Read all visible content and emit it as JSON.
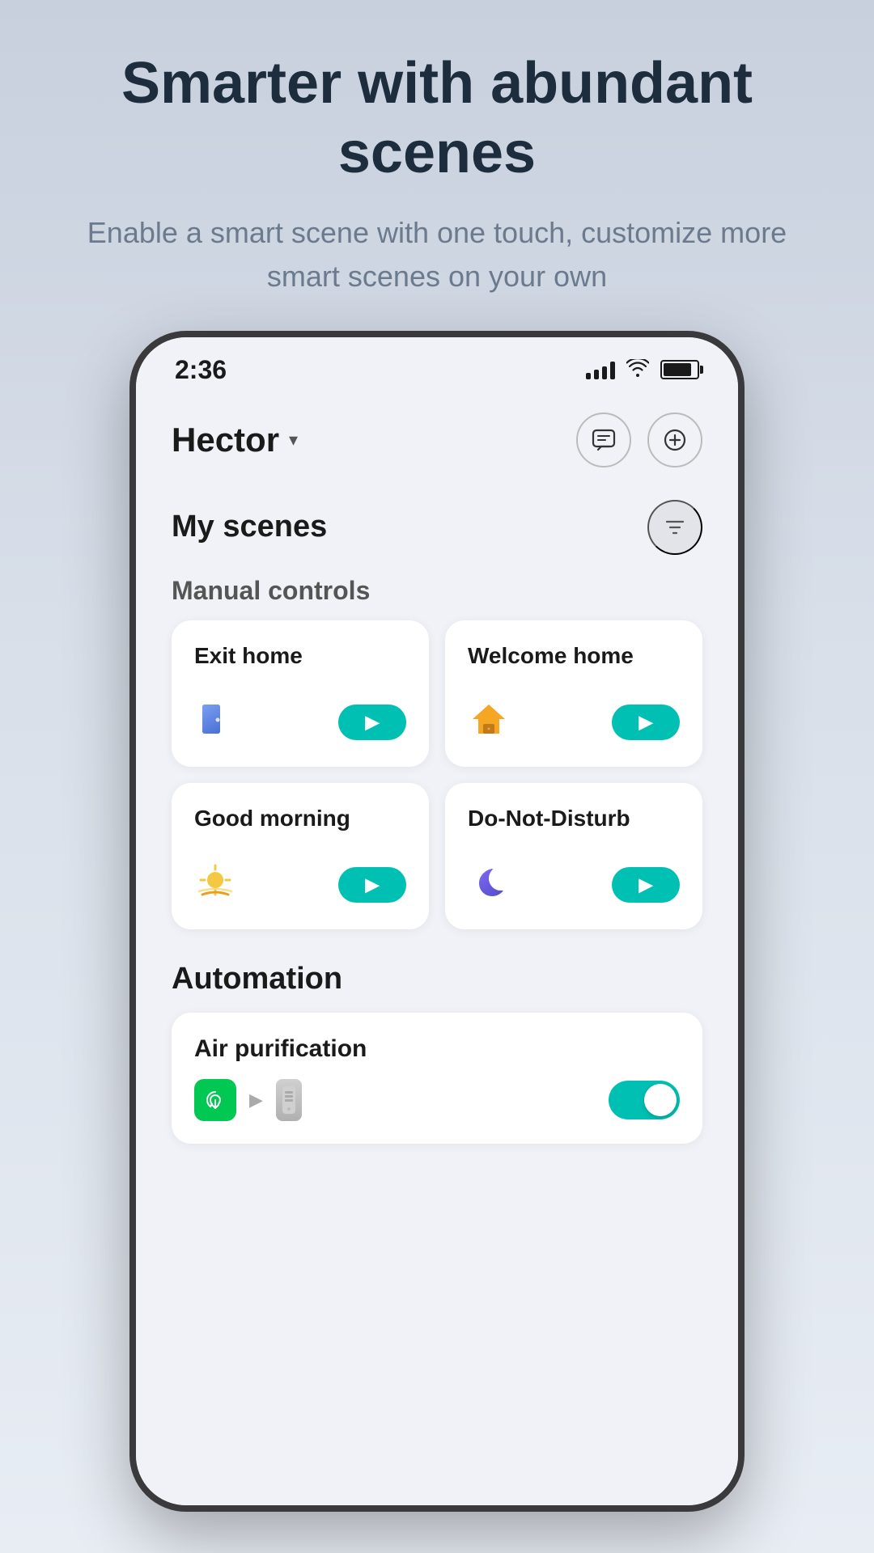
{
  "promo": {
    "title": "Smarter with abundant scenes",
    "subtitle": "Enable a smart scene with one touch, customize more smart scenes on your own"
  },
  "status_bar": {
    "time": "2:36",
    "signal_aria": "signal bars",
    "wifi_aria": "wifi",
    "battery_aria": "battery"
  },
  "header": {
    "user_name": "Hector",
    "message_icon": "💬",
    "add_icon": "+"
  },
  "my_scenes": {
    "title": "My scenes",
    "filter_icon": "▽",
    "manual_controls": {
      "label": "Manual controls",
      "scenes": [
        {
          "title": "Exit home",
          "icon": "🚪",
          "icon_type": "door"
        },
        {
          "title": "Welcome home",
          "icon": "🏠",
          "icon_type": "house"
        },
        {
          "title": "Good morning",
          "icon": "🌅",
          "icon_type": "sunrise"
        },
        {
          "title": "Do-Not-Disturb",
          "icon": "🌙",
          "icon_type": "moon"
        }
      ],
      "run_button_aria": "run scene"
    }
  },
  "automation": {
    "title": "Automation",
    "items": [
      {
        "title": "Air purification",
        "enabled": true,
        "source_icon": "🍃",
        "target_device": "purifier"
      }
    ]
  }
}
